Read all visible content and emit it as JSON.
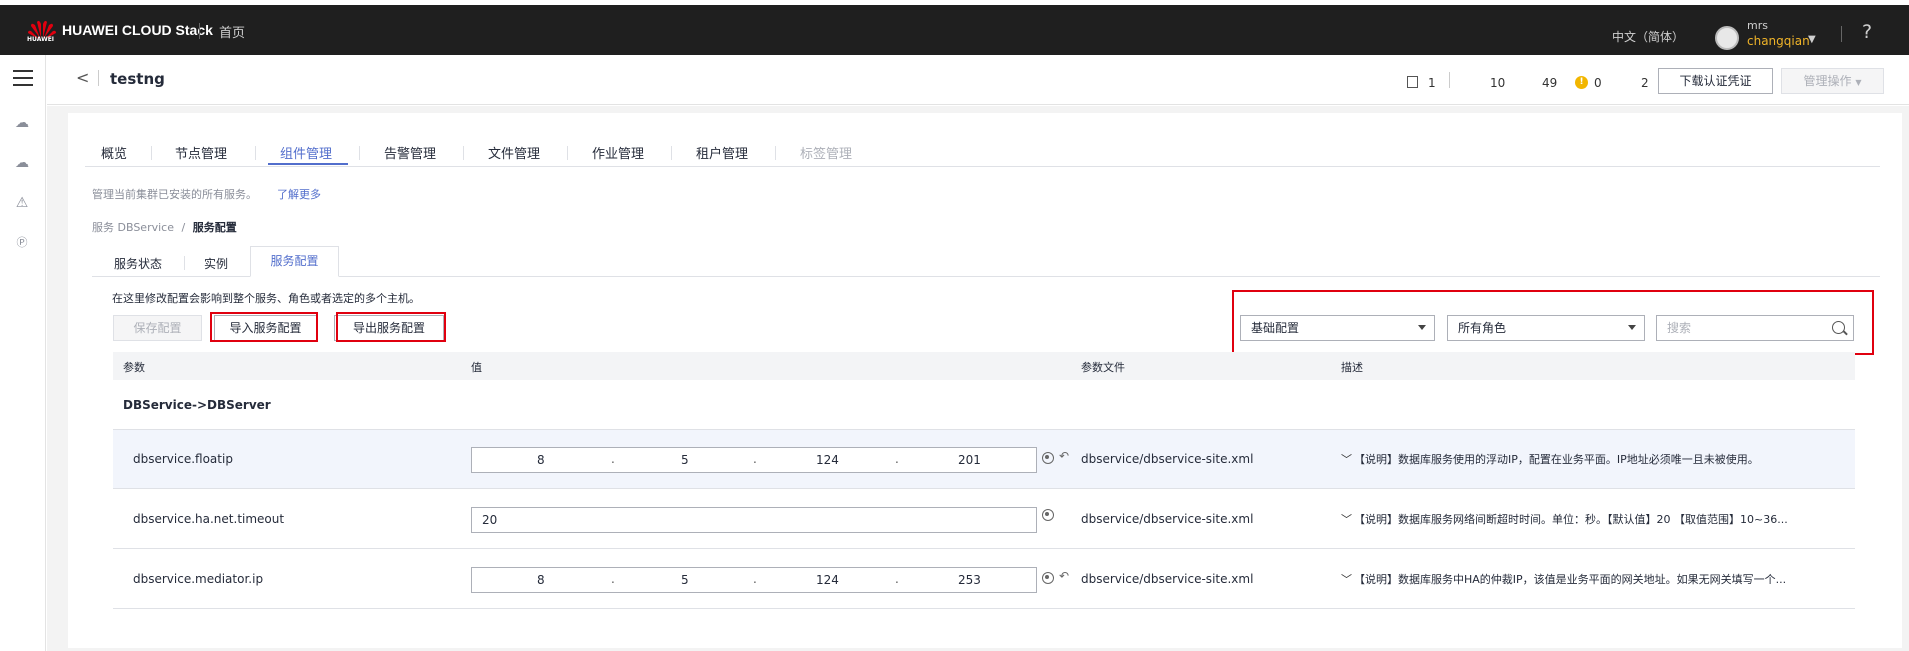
{
  "topbar": {
    "logo_text": "HUAWEI",
    "brand": "HUAWEI CLOUD Stack",
    "home": "首页",
    "language": "中文（简体）",
    "user_top": "mrs",
    "user_name": "changqian",
    "help": "?"
  },
  "header": {
    "back": "<",
    "title": "testng",
    "stats": {
      "hosts": "1",
      "stat2": "10",
      "stat3": "49",
      "warnings": "0",
      "stat5": "2"
    },
    "download_button": "下载认证凭证",
    "manage_button": "管理操作"
  },
  "tabs": [
    {
      "label": "概览"
    },
    {
      "label": "节点管理"
    },
    {
      "label": "组件管理",
      "active": true
    },
    {
      "label": "告警管理"
    },
    {
      "label": "文件管理"
    },
    {
      "label": "作业管理"
    },
    {
      "label": "租户管理"
    },
    {
      "label": "标签管理",
      "disabled": true
    }
  ],
  "description": "管理当前集群已安装的所有服务。",
  "learn_more": "了解更多",
  "breadcrumb": {
    "parent": "服务 DBService",
    "sep": "/",
    "current": "服务配置"
  },
  "subtabs": [
    "服务状态",
    "实例",
    "服务配置"
  ],
  "hint": "在这里修改配置会影响到整个服务、角色或者选定的多个主机。",
  "buttons": {
    "save": "保存配置",
    "import": "导入服务配置",
    "export": "导出服务配置"
  },
  "filters": {
    "config_type": "基础配置",
    "role": "所有角色",
    "search_placeholder": "搜索"
  },
  "table": {
    "headers": [
      "参数",
      "值",
      "参数文件",
      "描述"
    ],
    "group": "DBService->DBServer",
    "rows": [
      {
        "param": "dbservice.floatip",
        "ip": [
          "8",
          "5",
          "124",
          "201"
        ],
        "file": "dbservice/dbservice-site.xml",
        "desc": "【说明】数据库服务使用的浮动IP，配置在业务平面。IP地址必须唯一且未被使用。"
      },
      {
        "param": "dbservice.ha.net.timeout",
        "value": "20",
        "file": "dbservice/dbservice-site.xml",
        "desc": "【说明】数据库服务网络间断超时时间。单位：秒。【默认值】20 【取值范围】10~36..."
      },
      {
        "param": "dbservice.mediator.ip",
        "ip": [
          "8",
          "5",
          "124",
          "253"
        ],
        "file": "dbservice/dbservice-site.xml",
        "desc": "【说明】数据库服务中HA的仲裁IP，该值是业务平面的网关地址。如果无网关填写一个..."
      }
    ]
  },
  "colors": {
    "accent": "#526ecc",
    "highlight_box": "#e0000f",
    "topbar": "#1f1f1f",
    "warning": "#f2b600"
  }
}
